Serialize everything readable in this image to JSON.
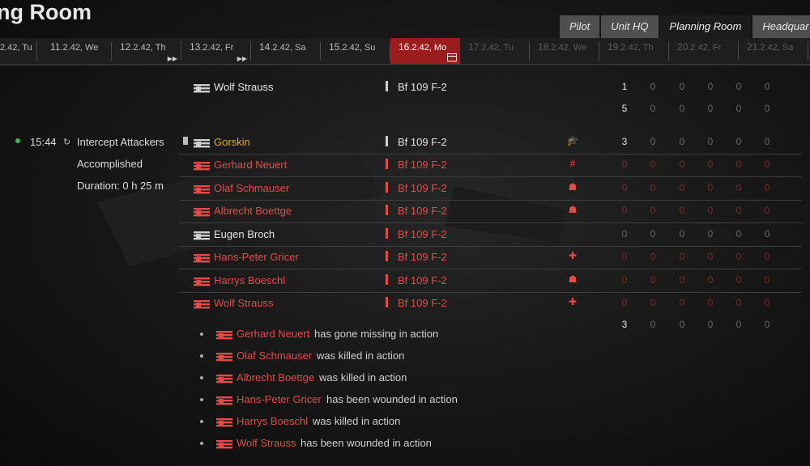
{
  "header": {
    "title": "ng Room"
  },
  "tabs": [
    "Pilot",
    "Unit HQ",
    "Planning Room",
    "Headquar"
  ],
  "active_tab": 2,
  "dates": [
    {
      "d": "",
      "rest": "2.42, Tu"
    },
    {
      "d": "11",
      "rest": ".2.42, We"
    },
    {
      "d": "12",
      "rest": ".2.42, Th"
    },
    {
      "d": "13",
      "rest": ".2.42, Fr"
    },
    {
      "d": "14",
      "rest": ".2.42, Sa"
    },
    {
      "d": "15",
      "rest": ".2.42, Su"
    },
    {
      "d": "16",
      "rest": ".2.42, Mo"
    },
    {
      "d": "17",
      "rest": ".2.42, Tu"
    },
    {
      "d": "18",
      "rest": ".2.42, We"
    },
    {
      "d": "19",
      "rest": ".2.42, Th"
    },
    {
      "d": "20",
      "rest": ".2.42, Fr"
    },
    {
      "d": "21",
      "rest": ".2.42, Sa"
    }
  ],
  "active_date": 6,
  "mission": {
    "time": "15:44",
    "name": "Intercept Attackers",
    "status": "Accomplished",
    "duration": "Duration: 0 h 25 m"
  },
  "top_row": {
    "name": "Wolf Strauss",
    "plane": "Bf 109 F-2",
    "stats": [
      "1",
      "0",
      "0",
      "0",
      "0",
      "0"
    ]
  },
  "top_summary": [
    "5",
    "0",
    "0",
    "0",
    "0",
    "0"
  ],
  "pilots": [
    {
      "name": "Gorskin",
      "plane": "Bf 109 F-2",
      "award": "🎓",
      "stats": [
        "3",
        "0",
        "0",
        "0",
        "0",
        "0"
      ]
    },
    {
      "name": "Gerhard Neuert",
      "plane": "Bf 109 F-2",
      "award": "#",
      "stats": [
        "0",
        "0",
        "0",
        "0",
        "0",
        "0"
      ]
    },
    {
      "name": "Olaf Schmauser",
      "plane": "Bf 109 F-2",
      "award": "☗",
      "stats": [
        "0",
        "0",
        "0",
        "0",
        "0",
        "0"
      ]
    },
    {
      "name": "Albrecht Boettge",
      "plane": "Bf 109 F-2",
      "award": "☗",
      "stats": [
        "0",
        "0",
        "0",
        "0",
        "0",
        "0"
      ]
    },
    {
      "name": "Eugen Broch",
      "plane": "Bf 109 F-2",
      "award": "",
      "stats": [
        "0",
        "0",
        "0",
        "0",
        "0",
        "0"
      ]
    },
    {
      "name": "Hans-Peter Gricer",
      "plane": "Bf 109 F-2",
      "award": "✚",
      "stats": [
        "0",
        "0",
        "0",
        "0",
        "0",
        "0"
      ]
    },
    {
      "name": "Harrys Boeschl",
      "plane": "Bf 109 F-2",
      "award": "☗",
      "stats": [
        "0",
        "0",
        "0",
        "0",
        "0",
        "0"
      ]
    },
    {
      "name": "Wolf Strauss",
      "plane": "Bf 109 F-2",
      "award": "✚",
      "stats": [
        "0",
        "0",
        "0",
        "0",
        "0",
        "0"
      ]
    }
  ],
  "bottom_summary": [
    "3",
    "0",
    "0",
    "0",
    "0",
    "0"
  ],
  "events": [
    {
      "name": "Gerhard Neuert",
      "text": "has gone missing in action"
    },
    {
      "name": "Olaf Schmauser",
      "text": "was killed in action"
    },
    {
      "name": "Albrecht Boettge",
      "text": "was killed in action"
    },
    {
      "name": "Hans-Peter Gricer",
      "text": "has been wounded in action"
    },
    {
      "name": "Harrys Boeschl",
      "text": "was killed in action"
    },
    {
      "name": "Wolf Strauss",
      "text": "has been wounded in action"
    }
  ],
  "colors": {
    "accent_red": "#e34b48",
    "gold": "#e8a626",
    "active_date_bg": "#9b1c1c",
    "status_ok": "#3ab84a"
  }
}
